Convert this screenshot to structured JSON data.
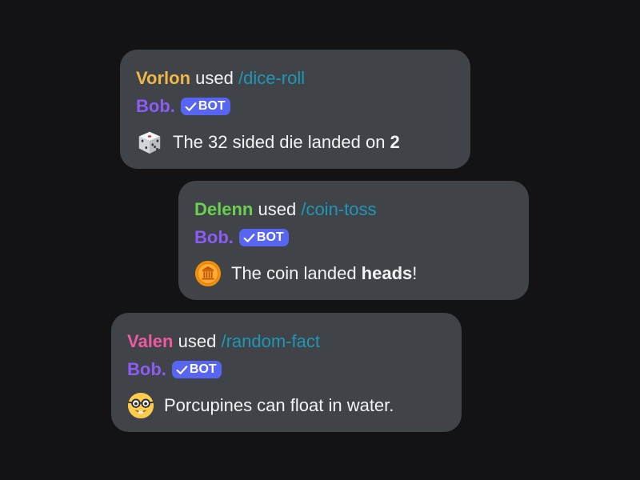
{
  "colors": {
    "background": "#131315",
    "card": "#404348",
    "command": "#1f97b5",
    "bot_name": "#8b5cf6",
    "bot_tag": "#5865f2"
  },
  "messages": [
    {
      "user": "Vorlon",
      "user_color": "#f0b648",
      "verb": "used",
      "command": "/dice-roll",
      "bot_name": "Bob.",
      "bot_tag": "BOT",
      "icon": "game-die-icon",
      "text_before": "The 32 sided die landed on ",
      "text_bold": "2",
      "text_after": ""
    },
    {
      "user": "Delenn",
      "user_color": "#6ad04f",
      "verb": "used",
      "command": "/coin-toss",
      "bot_name": "Bob.",
      "bot_tag": "BOT",
      "icon": "coin-icon",
      "text_before": "The coin landed ",
      "text_bold": "heads",
      "text_after": "!"
    },
    {
      "user": "Valen",
      "user_color": "#ee5a9f",
      "verb": "used",
      "command": "/random-fact",
      "bot_name": "Bob.",
      "bot_tag": "BOT",
      "icon": "nerd-face-icon",
      "text_before": "Porcupines can float in water.",
      "text_bold": "",
      "text_after": ""
    }
  ]
}
